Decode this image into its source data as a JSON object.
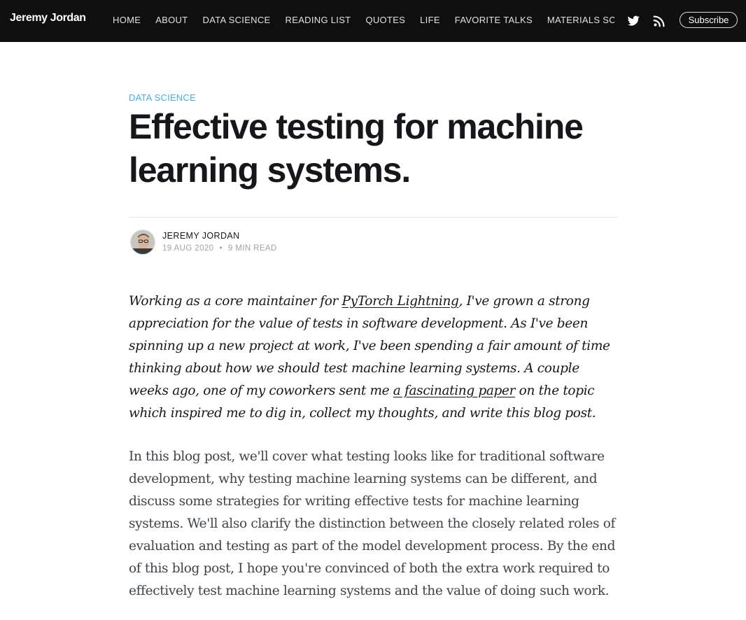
{
  "site": {
    "title": "Jeremy Jordan",
    "nav_items": [
      "HOME",
      "ABOUT",
      "DATA SCIENCE",
      "READING LIST",
      "QUOTES",
      "LIFE",
      "FAVORITE TALKS",
      "MATERIALS SCIENCE"
    ],
    "social_icons": [
      "twitter-icon",
      "rss-icon"
    ],
    "subscribe_label": "Subscribe",
    "colors": {
      "nav_bg": "#0f0f0f",
      "accent": "#3eb0ef",
      "text": "#15171a"
    }
  },
  "post": {
    "tag": "DATA SCIENCE",
    "title": "Effective testing for machine learning systems.",
    "author": "JEREMY JORDAN",
    "date": "19 AUG 2020",
    "read_time": "9 MIN READ",
    "intro": {
      "part1": "Working as a core maintainer for ",
      "link1": "PyTorch Lightning",
      "part2": ", I've grown a strong appreciation for the value of tests in software development. As I've been spinning up a new project at work, I've been spending a fair amount of time thinking about how we should test machine learning systems. A couple weeks ago, one of my coworkers sent me ",
      "link2": "a fascinating paper",
      "part3": " on the topic which inspired me to dig in, collect my thoughts, and write this blog post."
    },
    "paragraph2": "In this blog post, we'll cover what testing looks like for traditional software development, why testing machine learning systems can be different, and discuss some strategies for writing effective tests for machine learning systems. We'll also clarify the distinction between the closely related roles of evaluation and testing as part of the model development process. By the end of this blog post, I hope you're convinced of both the extra work required to effectively test machine learning systems and the value of doing such work."
  }
}
